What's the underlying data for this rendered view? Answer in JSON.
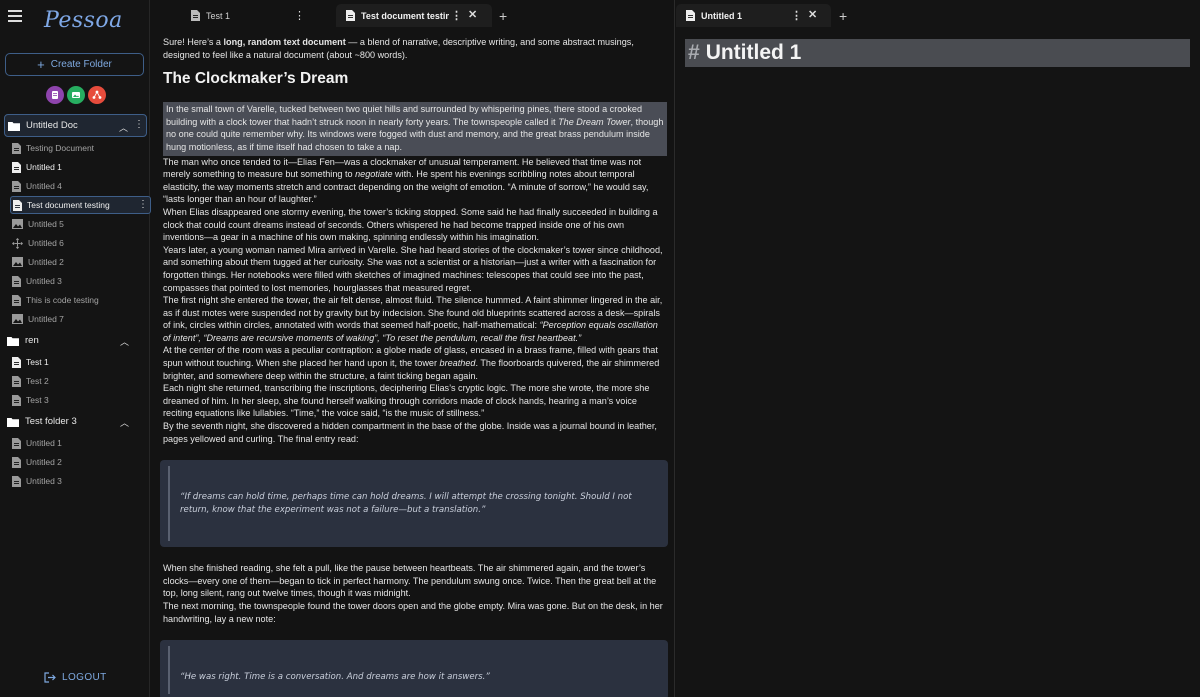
{
  "app": {
    "logo": "Pessoa"
  },
  "sidebar": {
    "create_folder_label": "Create Folder",
    "type_icons": [
      {
        "name": "document-type-icon",
        "color": "#8e44ad"
      },
      {
        "name": "image-type-icon",
        "color": "#27ae60"
      },
      {
        "name": "diagram-type-icon",
        "color": "#e74c3c"
      }
    ],
    "folders": [
      {
        "label": "Untitled Doc",
        "items": [
          "Testing Document",
          "Untitled 1",
          "Untitled 4",
          "Test document testing",
          "Untitled 5",
          "Untitled 6",
          "Untitled 2",
          "Untitled 3",
          "This is code testing",
          "Untitled 7"
        ]
      },
      {
        "label": "ren",
        "items": [
          "Test 1",
          "Test 2",
          "Test 3"
        ]
      },
      {
        "label": "Test folder 3",
        "items": [
          "Untitled 1",
          "Untitled 2",
          "Untitled 3"
        ]
      }
    ],
    "logout_label": "LOGOUT"
  },
  "left_pane": {
    "tabs": [
      {
        "label": "Test 1"
      },
      {
        "label": "Test document testing"
      }
    ],
    "doc": {
      "intro_a": "Sure! Here’s a ",
      "intro_b": "long, random text document",
      "intro_c": " — a blend of narrative, descriptive writing, and some abstract musings, designed to feel like a natural document (about ~800 words).",
      "title": "The Clockmaker’s Dream",
      "p1a": "In the small town of Varelle, tucked between two quiet hills and surrounded by whispering pines, there stood a crooked building with a clock tower that hadn’t struck noon in nearly forty years. The townspeople called it ",
      "p1b": "The Dream Tower",
      "p1c": ", though no one could quite remember why. Its windows were fogged with dust and memory, and the great brass pendulum inside hung motionless, as if time itself had chosen to take a nap.",
      "p2a": "The man who once tended to it—Elias Fen—was a clockmaker of unusual temperament. He believed that time was not merely something to measure but something to ",
      "p2b": "negotiate",
      "p2c": " with. He spent his evenings scribbling notes about temporal elasticity, the way moments stretch and contract depending on the weight of emotion. “A minute of sorrow,” he would say, “lasts longer than an hour of laughter.”",
      "p3": "When Elias disappeared one stormy evening, the tower’s ticking stopped. Some said he had finally succeeded in building a clock that could count dreams instead of seconds. Others whispered he had become trapped inside one of his own inventions—a gear in a machine of his own making, spinning endlessly within his imagination.",
      "p4": "Years later, a young woman named Mira arrived in Varelle. She had heard stories of the clockmaker’s tower since childhood, and something about them tugged at her curiosity. She was not a scientist or a historian—just a writer with a fascination for forgotten things. Her notebooks were filled with sketches of imagined machines: telescopes that could see into the past, compasses that pointed to lost memories, hourglasses that measured regret.",
      "p5a": "The first night she entered the tower, the air felt dense, almost fluid. The silence hummed. A faint shimmer lingered in the air, as if dust motes were suspended not by gravity but by indecision. She found old blueprints scattered across a desk—spirals of ink, circles within circles, annotated with words that seemed half-poetic, half-mathematical: ",
      "p5b": "“Perception equals oscillation of intent”, “Dreams are recursive moments of waking”, “To reset the pendulum, recall the first heartbeat.”",
      "p6a": "At the center of the room was a peculiar contraption: a globe made of glass, encased in a brass frame, filled with gears that spun without touching. When she placed her hand upon it, the tower ",
      "p6b": "breathed",
      "p6c": ". The floorboards quivered, the air shimmered brighter, and somewhere deep within the structure, a faint ticking began again.",
      "p7": "Each night she returned, transcribing the inscriptions, deciphering Elias’s cryptic logic. The more she wrote, the more she dreamed of him. In her sleep, she found herself walking through corridors made of clock hands, hearing a man’s voice reciting equations like lullabies. “Time,” the voice said, “is the music of stillness.”",
      "p8": "By the seventh night, she discovered a hidden compartment in the base of the globe. Inside was a journal bound in leather, pages yellowed and curling. The final entry read:",
      "quote1": "“If dreams can hold time, perhaps time can hold dreams. I will attempt the crossing tonight. Should I not return, know that the experiment was not a failure—but a translation.”",
      "p9": "When she finished reading, she felt a pull, like the pause between heartbeats. The air shimmered again, and the tower’s clocks—every one of them—began to tick in perfect harmony. The pendulum swung once. Twice. Then the great bell at the top, long silent, rang out twelve times, though it was midnight.",
      "p10": "The next morning, the townspeople found the tower doors open and the globe empty. Mira was gone. But on the desk, in her handwriting, lay a new note:",
      "quote2": "“He was right. Time is a conversation. And dreams are how it answers.”"
    }
  },
  "right_pane": {
    "tabs": [
      {
        "label": "Untitled 1"
      }
    ],
    "doc_hash": "#",
    "doc_title": "Untitled 1"
  }
}
